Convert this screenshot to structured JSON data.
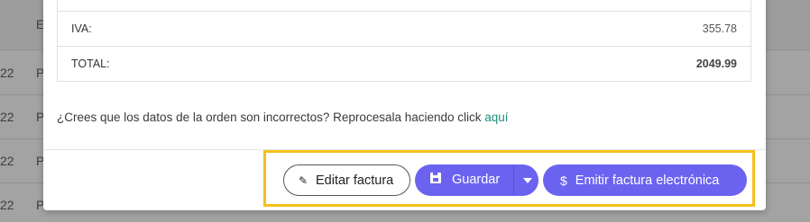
{
  "background_table": {
    "header_initial": "E",
    "rows": [
      {
        "col1": "22",
        "col2": "P"
      },
      {
        "col1": "22",
        "col2": "P"
      },
      {
        "col1": "22",
        "col2": "P"
      },
      {
        "col1": "22",
        "col2": "P"
      }
    ]
  },
  "totals": {
    "iva_label": "IVA:",
    "iva_value": "355.78",
    "total_label": "TOTAL:",
    "total_value": "2049.99"
  },
  "note": {
    "text": "¿Crees que los datos de la orden son incorrectos? Reprocesala haciendo click ",
    "link": "aquí"
  },
  "actions": {
    "edit_label": "Editar factura",
    "save_label": "Guardar",
    "emit_label": "Emitir factura electrónica"
  },
  "colors": {
    "primary": "#6b63f0",
    "link": "#1c8f7f",
    "highlight": "#f4c01a"
  }
}
